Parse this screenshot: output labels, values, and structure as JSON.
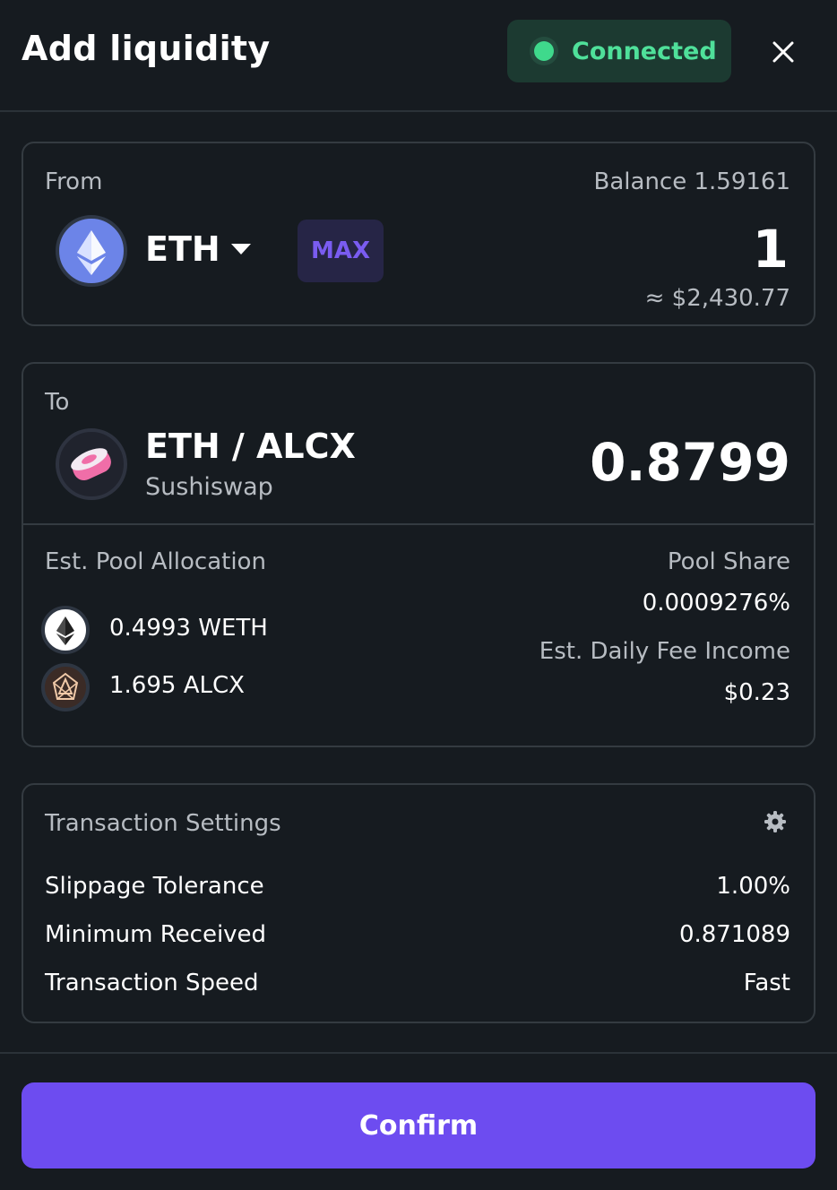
{
  "header": {
    "title": "Add liquidity",
    "status": "Connected",
    "close_icon": "close-icon"
  },
  "from": {
    "label": "From",
    "balance": "Balance 1.59161",
    "token": "ETH",
    "max_label": "MAX",
    "amount": "1",
    "usd_value": "≈ $2,430.77"
  },
  "to": {
    "label": "To",
    "pair": "ETH / ALCX",
    "dex": "Sushiswap",
    "amount": "0.8799"
  },
  "pool": {
    "allocation_label": "Est. Pool Allocation",
    "tokens": [
      {
        "amount": "0.4993 WETH",
        "icon": "weth-icon"
      },
      {
        "amount": "1.695 ALCX",
        "icon": "alcx-icon"
      }
    ],
    "share_label": "Pool Share",
    "share_value": "0.0009276%",
    "fee_label": "Est. Daily Fee Income",
    "fee_value": "$0.23"
  },
  "settings": {
    "title": "Transaction Settings",
    "rows": [
      {
        "label": "Slippage Tolerance",
        "value": "1.00%"
      },
      {
        "label": "Minimum Received",
        "value": "0.871089"
      },
      {
        "label": "Transaction Speed",
        "value": "Fast"
      }
    ]
  },
  "confirm_label": "Confirm",
  "colors": {
    "background": "#161b20",
    "accent": "#6d4cf0",
    "connected": "#4fe09a",
    "max": "#7a5cf0"
  }
}
